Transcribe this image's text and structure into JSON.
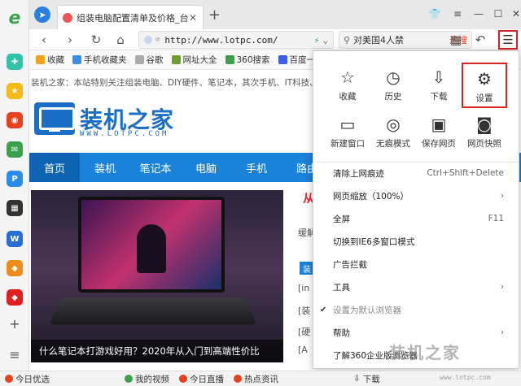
{
  "tab": {
    "title": "组装电脑配置清单及价格_台式电脑"
  },
  "address": {
    "url": "http://www.lotpc.com/"
  },
  "search": {
    "query": "对美国4人禁",
    "hot_label": "热搜"
  },
  "bookmarks": [
    {
      "label": "收藏",
      "color": "#f2a21e"
    },
    {
      "label": "手机收藏夹",
      "color": "#3a8ee8"
    },
    {
      "label": "谷歌",
      "color": "#aaaaaa"
    },
    {
      "label": "网址大全",
      "color": "#6b9e2b"
    },
    {
      "label": "360搜索",
      "color": "#3aa24a"
    },
    {
      "label": "百度一下",
      "color": "#3a5ee8"
    }
  ],
  "page": {
    "topline": "装机之家：本站特别关注组装电脑、DIY硬件、笔记本，其次手机、IT科技、数",
    "logo_text": "装机之家",
    "logo_sub": "WWW.LOTPC.COM",
    "nav": [
      "首页",
      "装机",
      "笔记本",
      "电脑",
      "手机",
      "路由"
    ],
    "hero_caption": "什么笔记本打游戏好用？2020年从入门到高端性价比",
    "side_head": "从",
    "side_lines": [
      "缓解",
      "[in",
      "[装",
      "[硬",
      "[A"
    ],
    "side_tag": "装"
  },
  "menu": {
    "grid": [
      {
        "label": "收藏",
        "icon": "star-icon",
        "glyph": "☆"
      },
      {
        "label": "历史",
        "icon": "clock-icon",
        "glyph": "◷"
      },
      {
        "label": "下载",
        "icon": "download-icon",
        "glyph": "⇩"
      },
      {
        "label": "设置",
        "icon": "gear-icon",
        "glyph": "⚙"
      },
      {
        "label": "新建窗口",
        "icon": "window-icon",
        "glyph": "▭"
      },
      {
        "label": "无痕模式",
        "icon": "incognito-icon",
        "glyph": "◎"
      },
      {
        "label": "保存网页",
        "icon": "save-icon",
        "glyph": "▣"
      },
      {
        "label": "网页快照",
        "icon": "camera-icon",
        "glyph": "◙"
      }
    ],
    "rows": [
      {
        "label": "清除上网痕迹",
        "right": "Ctrl+Shift+Delete"
      },
      {
        "label": "网页缩放（100%）",
        "right": "›"
      },
      {
        "label": "全屏",
        "right": "F11"
      },
      {
        "label": "切换到IE6多窗口模式",
        "right": ""
      },
      {
        "label": "广告拦截",
        "right": ""
      },
      {
        "label": "工具",
        "right": "›"
      },
      {
        "label": "设置为默认浏览器",
        "right": "",
        "checked": true
      },
      {
        "label": "帮助",
        "right": "›"
      },
      {
        "label": "了解360企业版浏览器",
        "right": ""
      }
    ]
  },
  "statusbar": [
    {
      "label": "今日优选",
      "color": "#e8401c"
    },
    {
      "label": "我的视频",
      "color": "#3aa24a"
    },
    {
      "label": "今日直播",
      "color": "#e8401c"
    },
    {
      "label": "热点资讯",
      "color": "#e8401c"
    },
    {
      "label": "下载",
      "color": "#666666"
    }
  ],
  "watermark": {
    "text": "装机之家",
    "sub": "www.lotpc.com"
  }
}
